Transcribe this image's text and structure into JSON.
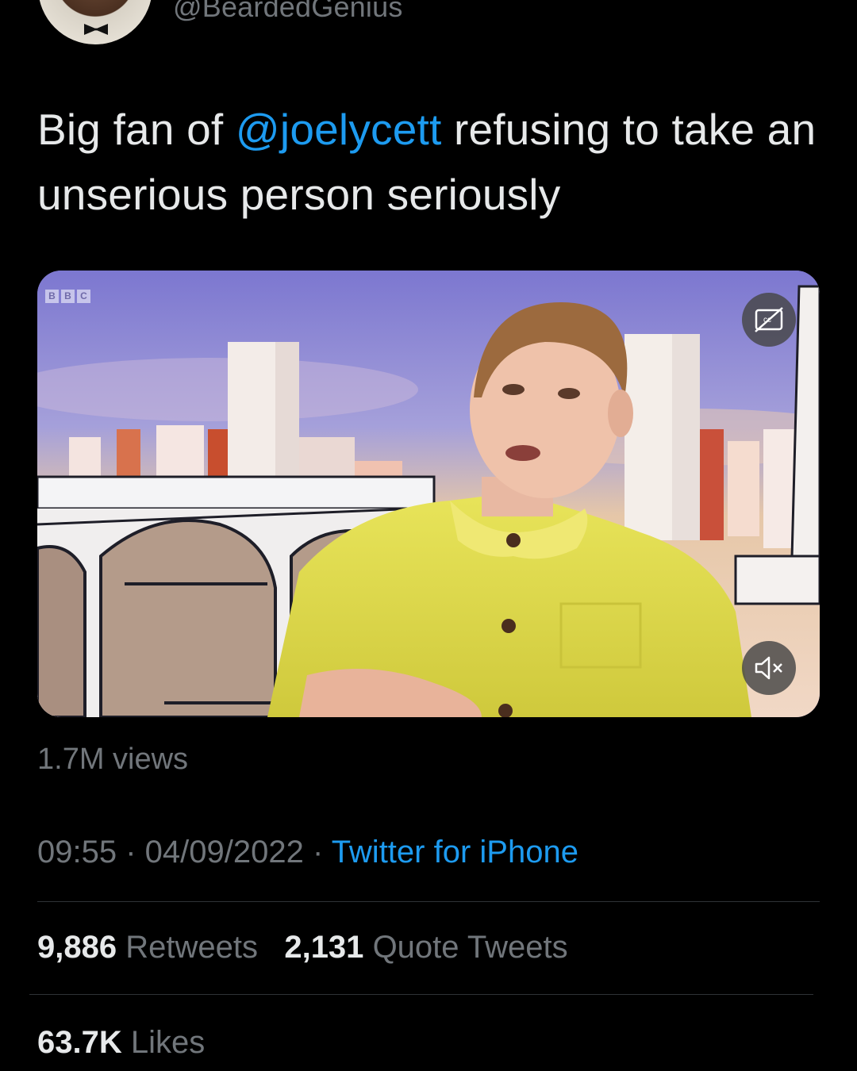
{
  "author": {
    "handle": "@BeardedGenius",
    "avatar_icon": "profile-avatar"
  },
  "tweet": {
    "text_before": "Big fan of ",
    "mention": "@joelycett",
    "text_after": " refusing to take an unserious person seriously"
  },
  "media": {
    "type": "video",
    "channel_logo": [
      "B",
      "B",
      "C"
    ],
    "cc_icon": "closed-captions-off-icon",
    "mute_icon": "volume-muted-icon"
  },
  "views": "1.7M views",
  "meta": {
    "time": "09:55",
    "separator": " · ",
    "date": "04/09/2022",
    "source": "Twitter for iPhone"
  },
  "stats": {
    "retweets_count": "9,886",
    "retweets_label": "Retweets",
    "quotes_count": "2,131",
    "quotes_label": "Quote Tweets",
    "likes_count": "63.7K",
    "likes_label": "Likes"
  },
  "colors": {
    "background": "#000000",
    "text": "#e7e9ea",
    "secondary": "#71767b",
    "accent": "#1d9bf0",
    "divider": "#2f3336"
  }
}
